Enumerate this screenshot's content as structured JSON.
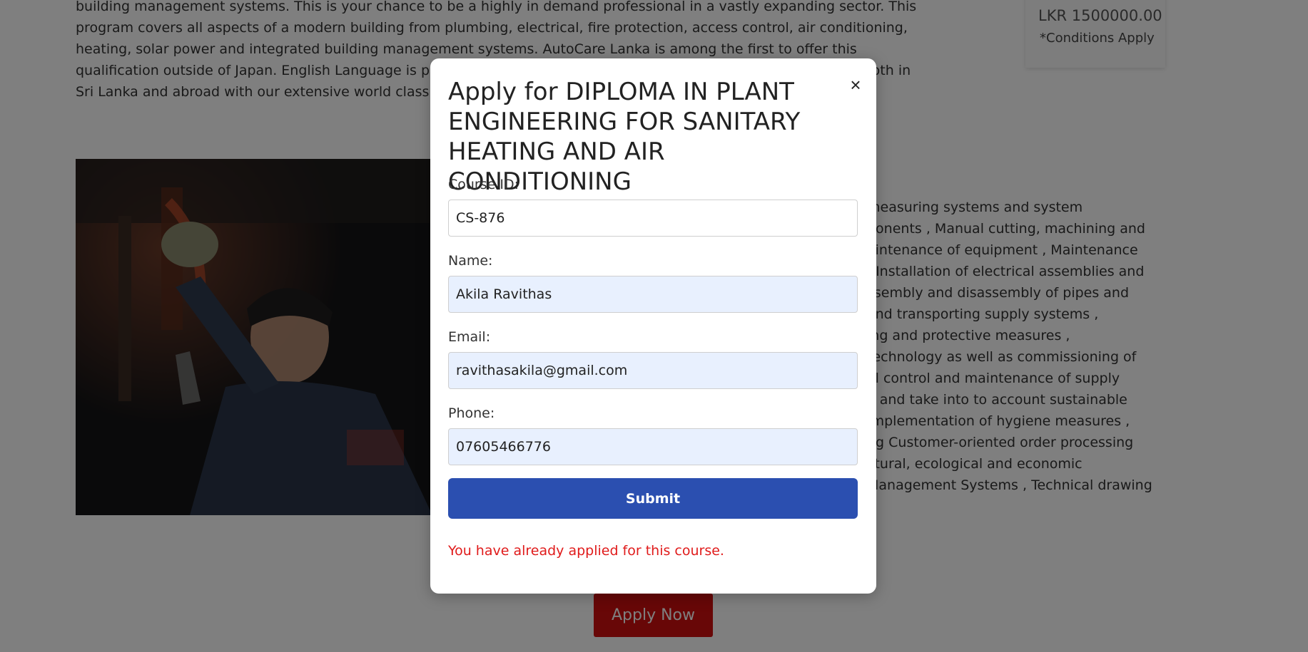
{
  "background": {
    "intro_paragraph": "building management systems. This is your chance to be a highly in demand professional in a vastly expanding sector. This program covers all aspects of a modern building from plumbing, electrical, fire protection, access control, air conditioning, heating, solar power and integrated building management systems. AutoCare Lanka is among the first to offer this qualification outside of Japan. English Language is part of the program to support future employment opportunities both in Sri Lanka and abroad with our extensive world class brands.",
    "price": {
      "value": "LKR 1500000.00",
      "note": "*Conditions Apply"
    },
    "course_description": "measuring systems and system\nponents , Manual cutting, machining and\naintenance of equipment , Maintenance\n, Installation of electrical assemblies and\nssembly and disassembly of pipes and\n and transporting supply systems ,\ning and protective measures ,\ntechnology as well as commissioning of\nal control and maintenance of supply\ne and take into to account sustainable\nImplementation of hygiene measures ,\nng Customer-oriented order processing\nctural, ecological and economic\nManagement Systems , Technical drawing",
    "apply_button_label": "Apply Now"
  },
  "modal": {
    "title": "Apply for DIPLOMA IN PLANT ENGINEERING FOR SANITARY HEATING AND AIR CONDITIONING",
    "close_symbol": "×",
    "fields": {
      "course_id": {
        "label": "Course ID:",
        "value": "CS-876"
      },
      "name": {
        "label": "Name:",
        "value": "Akila Ravithas"
      },
      "email": {
        "label": "Email:",
        "value": "ravithasakila@gmail.com"
      },
      "phone": {
        "label": "Phone:",
        "value": "07605466776"
      }
    },
    "submit_label": "Submit",
    "error_message": "You have already applied for this course."
  },
  "colors": {
    "submit_button": "#2b4fb0",
    "apply_button": "#d10f0f",
    "error_text": "#e01b1b",
    "autofill_field": "#e8f0fe"
  }
}
